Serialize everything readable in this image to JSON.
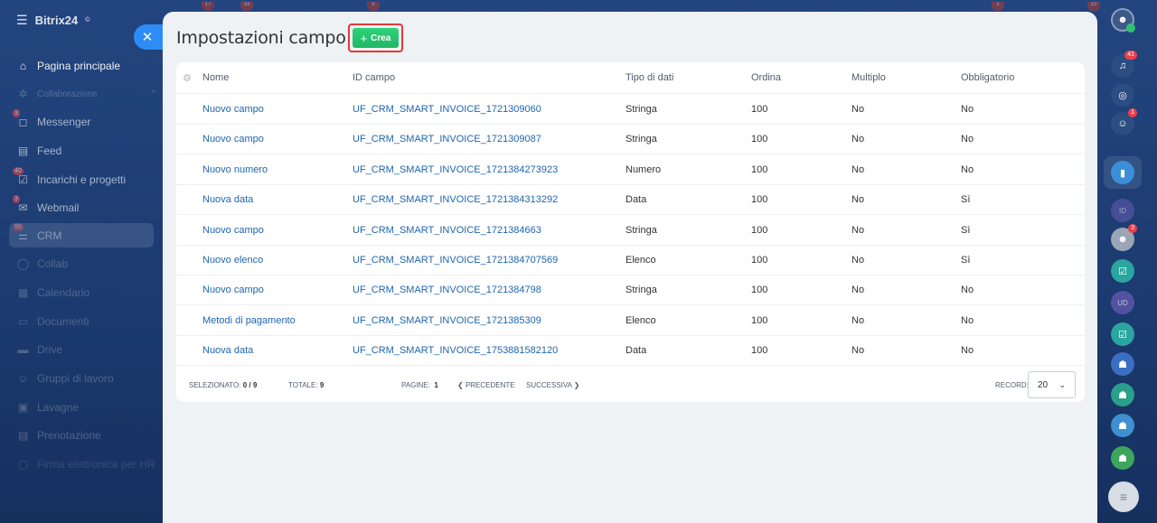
{
  "app": {
    "name": "Bitrix24",
    "brand_suffix": "©"
  },
  "top_counters": [
    "17",
    "33",
    "5",
    "1",
    "23"
  ],
  "sidebar": {
    "items": [
      {
        "label": "Pagina principale",
        "icon": "home-icon",
        "counter": ""
      },
      {
        "label": "Collaborazione",
        "icon": "collab-icon",
        "counter": ""
      },
      {
        "label": "Messenger",
        "icon": "chat-icon",
        "counter": "3"
      },
      {
        "label": "Feed",
        "icon": "feed-icon",
        "counter": ""
      },
      {
        "label": "Incarichi e progetti",
        "icon": "tasks-icon",
        "counter": "40"
      },
      {
        "label": "Webmail",
        "icon": "mail-icon",
        "counter": "3"
      },
      {
        "label": "CRM",
        "icon": "crm-icon",
        "counter": "55"
      },
      {
        "label": "Collab",
        "icon": "collab-circle-icon",
        "counter": ""
      },
      {
        "label": "Calendario",
        "icon": "calendar-icon",
        "counter": ""
      },
      {
        "label": "Documenti",
        "icon": "docs-icon",
        "counter": ""
      },
      {
        "label": "Drive",
        "icon": "drive-icon",
        "counter": ""
      },
      {
        "label": "Gruppi di lavoro",
        "icon": "groups-icon",
        "counter": ""
      },
      {
        "label": "Lavagne",
        "icon": "boards-icon",
        "counter": ""
      },
      {
        "label": "Prenotazione",
        "icon": "booking-icon",
        "counter": ""
      },
      {
        "label": "Firma elettronica per HR",
        "icon": "sign-icon",
        "counter": ""
      }
    ]
  },
  "header": {
    "title": "Impostazioni campo",
    "create_label": "Crea"
  },
  "table": {
    "columns": {
      "name": "Nome",
      "id": "ID campo",
      "type": "Tipo di dati",
      "order": "Ordina",
      "multiple": "Multiplo",
      "required": "Obbligatorio"
    },
    "rows": [
      {
        "name": "Nuovo campo",
        "id": "UF_CRM_SMART_INVOICE_1721309060",
        "type": "Stringa",
        "order": "100",
        "multiple": "No",
        "required": "No"
      },
      {
        "name": "Nuovo campo",
        "id": "UF_CRM_SMART_INVOICE_1721309087",
        "type": "Stringa",
        "order": "100",
        "multiple": "No",
        "required": "No"
      },
      {
        "name": "Nuovo numero",
        "id": "UF_CRM_SMART_INVOICE_1721384273923",
        "type": "Numero",
        "order": "100",
        "multiple": "No",
        "required": "No"
      },
      {
        "name": "Nuova data",
        "id": "UF_CRM_SMART_INVOICE_1721384313292",
        "type": "Data",
        "order": "100",
        "multiple": "No",
        "required": "Sì"
      },
      {
        "name": "Nuovo campo",
        "id": "UF_CRM_SMART_INVOICE_1721384663",
        "type": "Stringa",
        "order": "100",
        "multiple": "No",
        "required": "Sì"
      },
      {
        "name": "Nuovo elenco",
        "id": "UF_CRM_SMART_INVOICE_1721384707569",
        "type": "Elenco",
        "order": "100",
        "multiple": "No",
        "required": "Sì"
      },
      {
        "name": "Nuovo campo",
        "id": "UF_CRM_SMART_INVOICE_1721384798",
        "type": "Stringa",
        "order": "100",
        "multiple": "No",
        "required": "No"
      },
      {
        "name": "Metodi di pagamento",
        "id": "UF_CRM_SMART_INVOICE_1721385309",
        "type": "Elenco",
        "order": "100",
        "multiple": "No",
        "required": "No"
      },
      {
        "name": "Nuova data",
        "id": "UF_CRM_SMART_INVOICE_1753881582120",
        "type": "Data",
        "order": "100",
        "multiple": "No",
        "required": "No"
      }
    ]
  },
  "footer": {
    "selected_label": "Selezionato:",
    "selected_value": "0 / 9",
    "total_label": "Totale:",
    "total_value": "9",
    "pages_label": "Pagine:",
    "pages_value": "1",
    "prev_label": "Precedente",
    "next_label": "Successiva",
    "records_label": "Record:",
    "records_value": "20"
  },
  "rightbar": {
    "notifications_count": "41",
    "chat_count": "1",
    "avatar_count": "3",
    "initials_1": "ID",
    "initials_2": "UD"
  },
  "colors": {
    "accent": "#2066b0",
    "create_button": "#20b866",
    "highlight_border": "#e53935",
    "badge": "#e9414a"
  }
}
